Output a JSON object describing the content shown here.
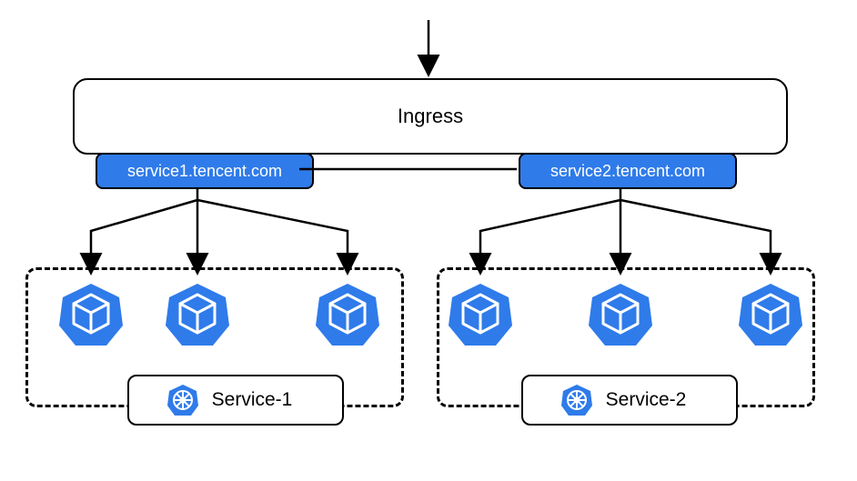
{
  "ingress": {
    "label": "Ingress"
  },
  "routes": [
    {
      "host": "service1.tencent.com",
      "service": "Service-1",
      "podCount": 3
    },
    {
      "host": "service2.tencent.com",
      "service": "Service-2",
      "podCount": 3
    }
  ],
  "colors": {
    "accent": "#2f7bea",
    "line": "#000000"
  }
}
